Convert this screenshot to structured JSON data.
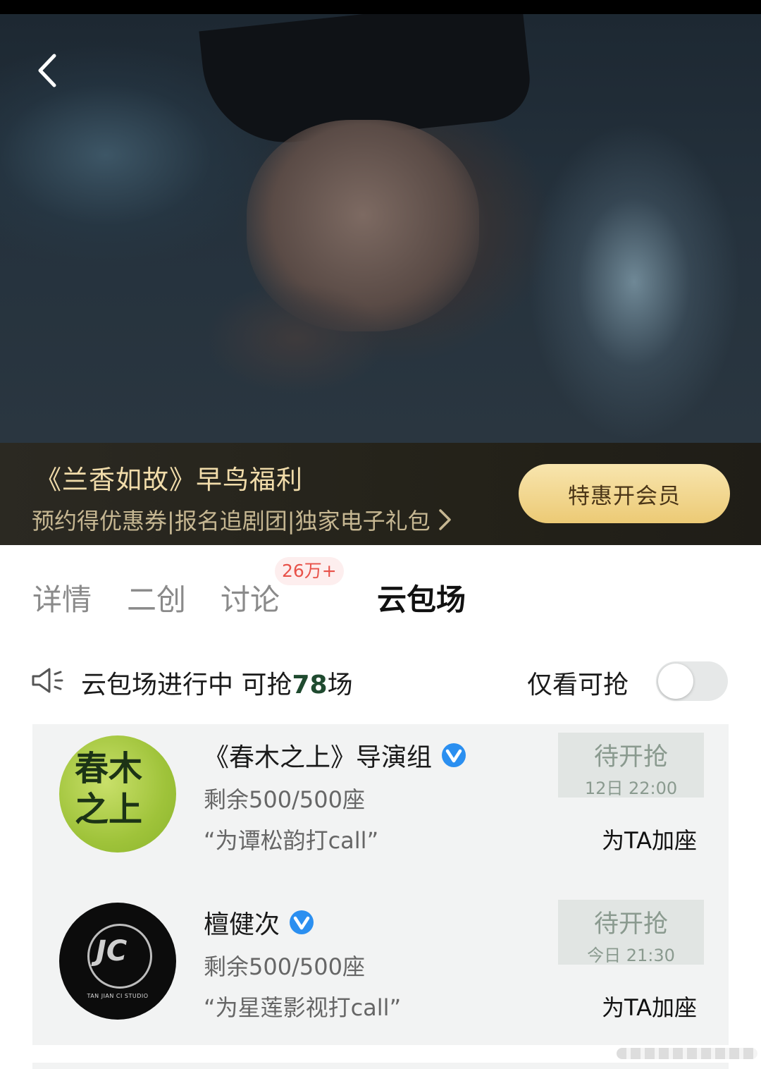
{
  "promo": {
    "title": "《兰香如故》早鸟福利",
    "subtitle": "预约得优惠券|报名追剧团|独家电子礼包",
    "vip_button": "特惠开会员"
  },
  "tabs": [
    {
      "label": "详情"
    },
    {
      "label": "二创"
    },
    {
      "label": "讨论",
      "badge": "26万+"
    },
    {
      "label": "云包场",
      "active": true
    }
  ],
  "status": {
    "text_prefix": "云包场进行中 可抢",
    "count": "78",
    "text_suffix": "场",
    "filter_label": "仅看可抢",
    "filter_on": false
  },
  "cards": [
    {
      "name": "《春木之上》导演组",
      "verified": true,
      "seats": "剩余500/500座",
      "slogan": "“为谭松韵打call”",
      "grab_title": "待开抢",
      "grab_time": "12日 22:00",
      "add_seat": "为TA加座",
      "avatar_text": "春木之上",
      "avatar_icon": "green-logo-avatar"
    },
    {
      "name": "檀健次",
      "verified": true,
      "seats": "剩余500/500座",
      "slogan": "“为星莲影视打call”",
      "grab_title": "待开抢",
      "grab_time": "今日 21:30",
      "add_seat": "为TA加座",
      "avatar_text": "TAN JIAN CI STUDIO",
      "avatar_icon": "jc-studio-logo-avatar"
    }
  ],
  "colors": {
    "accent_gold": "#ecca75",
    "verified_blue": "#2b8ff0",
    "badge_red": "#e8524a"
  }
}
